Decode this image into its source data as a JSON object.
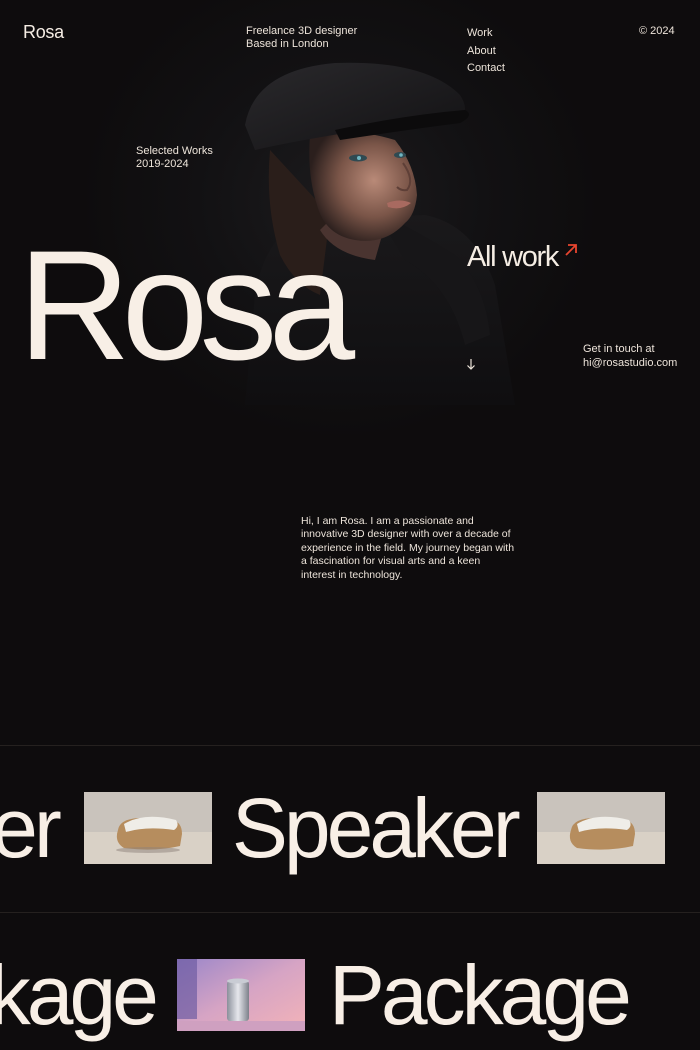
{
  "header": {
    "logo": "Rosa",
    "tagline_line1": "Freelance 3D designer",
    "tagline_line2": "Based in London",
    "nav": [
      "Work",
      "About",
      "Contact"
    ],
    "copyright": "© 2024"
  },
  "hero": {
    "selected_line1": "Selected Works",
    "selected_line2": "2019-2024",
    "name": "Rosa",
    "all_work": "All work",
    "contact_line1": "Get in touch at",
    "contact_line2": "hi@rosastudio.com"
  },
  "bio": {
    "text": "Hi, I am Rosa. I am a passionate and innovative 3D designer with over a decade of experience in the field. My journey began with a fascination for visual arts and a keen interest in technology."
  },
  "marquee": {
    "row1_word": "Speaker",
    "row2_word": "Package"
  },
  "colors": {
    "background": "#0e0c0d",
    "text": "#f5ede4",
    "accent": "#e8452f"
  },
  "icons": {
    "all_work_arrow": "arrow-up-right-icon",
    "scroll_arrow": "arrow-down-icon"
  }
}
